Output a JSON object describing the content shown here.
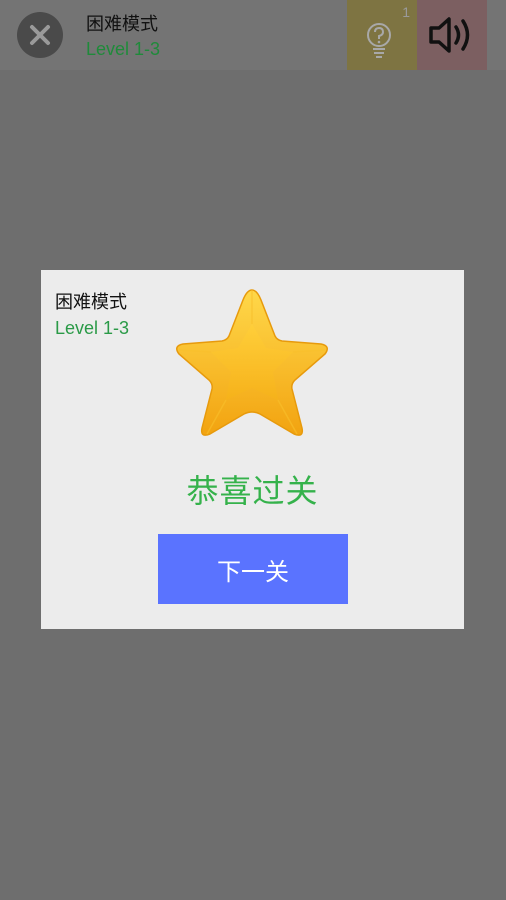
{
  "header": {
    "mode_title": "困难模式",
    "level_label": "Level 1-3",
    "hint_count": "1",
    "close_icon": "close-icon",
    "hint_icon": "lightbulb-question-icon",
    "sound_icon": "speaker-icon"
  },
  "dialog": {
    "mode_title": "困难模式",
    "level_label": "Level 1-3",
    "star_icon": "star-icon",
    "message": "恭喜过关",
    "next_button_label": "下一关"
  },
  "colors": {
    "level_green": "#1f8a3a",
    "congrats_green": "#35b24b",
    "button_blue": "#5a73ff",
    "star_gold": "#f7b81c"
  }
}
